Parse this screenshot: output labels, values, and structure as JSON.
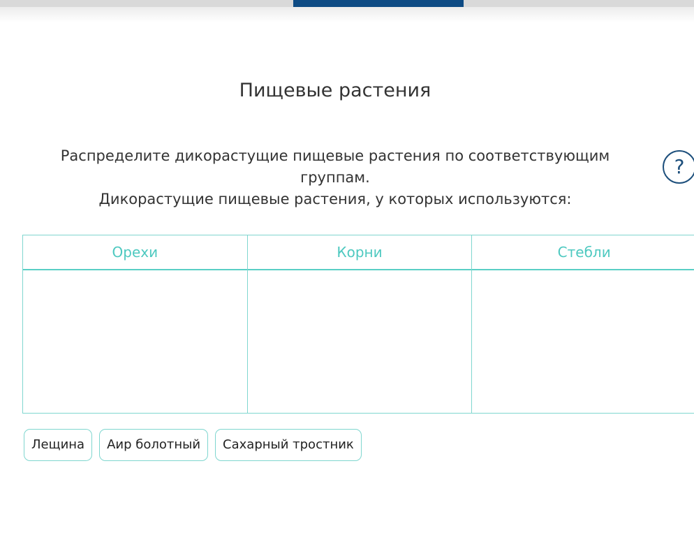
{
  "title": "Пищевые растения",
  "instructions": {
    "line1": "Распределите дикорастущие пищевые растения по соответствующим группам.",
    "line2": "Дикорастущие пищевые растения, у которых используются:"
  },
  "help": {
    "label": "?",
    "icon": "question-circle-icon"
  },
  "groups": [
    {
      "label": "Орехи"
    },
    {
      "label": "Корни"
    },
    {
      "label": "Стебли"
    }
  ],
  "items": [
    {
      "label": "Лещина"
    },
    {
      "label": "Аир болотный"
    },
    {
      "label": "Сахарный тростник"
    }
  ],
  "colors": {
    "accent": "#4ec9c0",
    "border": "#7fd6cf",
    "top_tab": "#0e4b84",
    "help": "#1d4f7c"
  }
}
